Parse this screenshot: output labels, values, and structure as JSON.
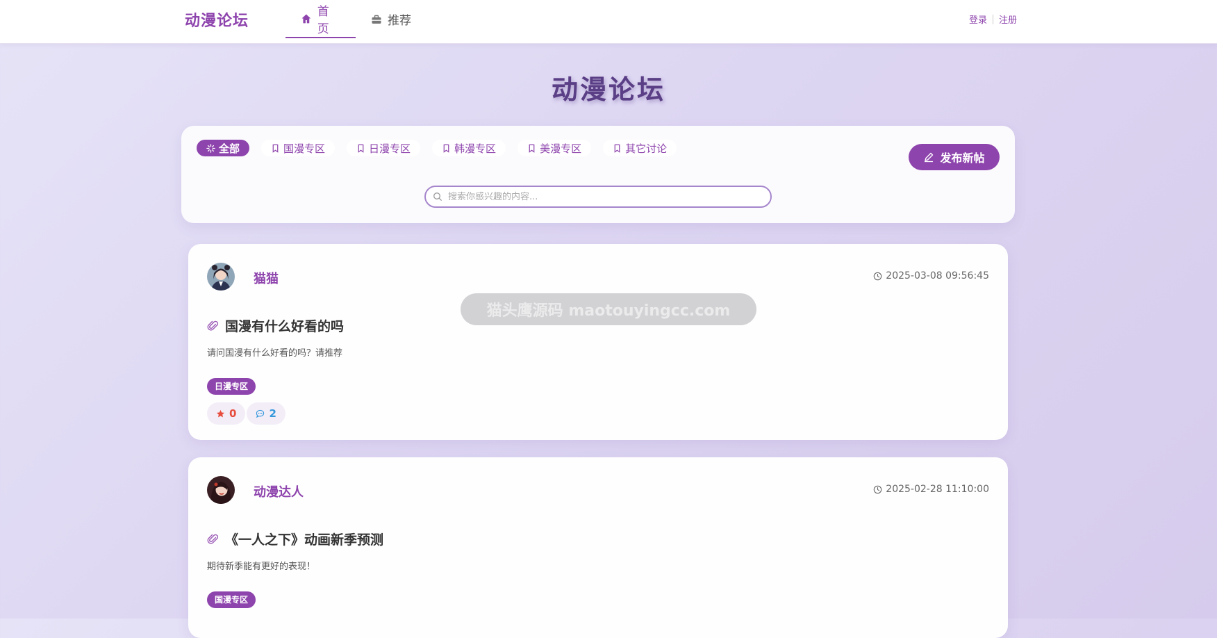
{
  "nav": {
    "brand": "动漫论坛",
    "tabs": [
      {
        "label": "首页",
        "icon": "home-icon",
        "active": true
      },
      {
        "label": "推荐",
        "icon": "briefcase-icon",
        "active": false
      }
    ],
    "login": "登录",
    "register": "注册"
  },
  "hero": {
    "title": "动漫论坛"
  },
  "filters": {
    "categories": [
      {
        "label": "全部",
        "icon": "sparkle-icon",
        "active": true
      },
      {
        "label": "国漫专区",
        "icon": "bookmark-icon"
      },
      {
        "label": "日漫专区",
        "icon": "bookmark-icon"
      },
      {
        "label": "韩漫专区",
        "icon": "bookmark-icon"
      },
      {
        "label": "美漫专区",
        "icon": "bookmark-icon"
      },
      {
        "label": "其它讨论",
        "icon": "bookmark-icon"
      }
    ],
    "post_button": "发布新帖",
    "search_placeholder": "搜索你感兴趣的内容..."
  },
  "posts": [
    {
      "author": "猫猫",
      "time": "2025-03-08 09:56:45",
      "title": "国漫有什么好看的吗",
      "body": "请问国漫有什么好看的吗？请推荐",
      "tag": "日漫专区",
      "likes": "0",
      "comments": "2"
    },
    {
      "author": "动漫达人",
      "time": "2025-02-28 11:10:00",
      "title": "《一人之下》动画新季预测",
      "body": "期待新季能有更好的表现！",
      "tag": "国漫专区"
    }
  ],
  "watermark": "猫头鹰源码 maotouyingcc.com",
  "colors": {
    "accent": "#8e44ad",
    "likes": "#e74c3c",
    "comments": "#3498db"
  }
}
